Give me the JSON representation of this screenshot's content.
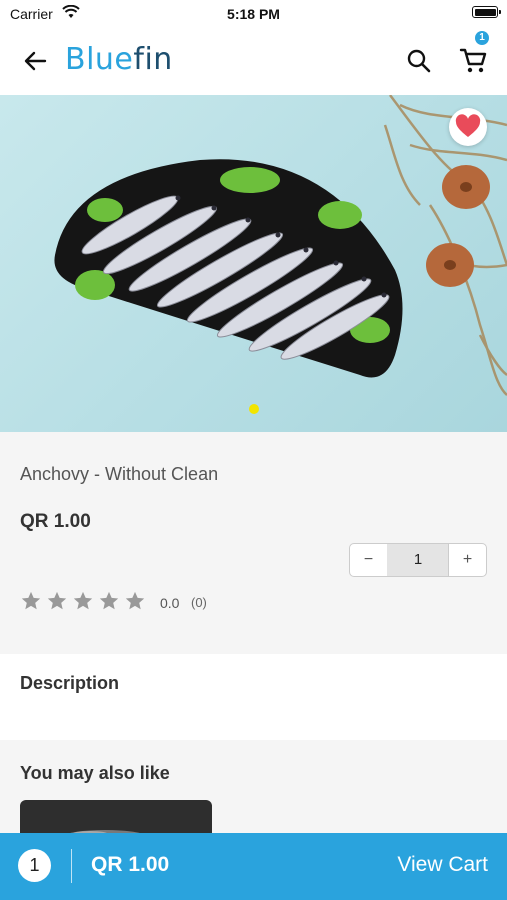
{
  "status_bar": {
    "carrier": "Carrier",
    "time": "5:18 PM"
  },
  "header": {
    "logo_prefix": "Blue",
    "logo_suffix": "fin",
    "cart_badge": "1"
  },
  "product": {
    "name": "Anchovy - Without Clean",
    "price": "QR 1.00",
    "quantity": "1",
    "minus_label": "−",
    "plus_label": "+",
    "rating": "0.0",
    "rating_count": "(0)",
    "stars_filled": 0,
    "stars_total": 5
  },
  "description": {
    "title": "Description"
  },
  "recommendations": {
    "title": "You may also like"
  },
  "bottom_bar": {
    "cart_count": "1",
    "total": "QR 1.00",
    "view_cart_label": "View Cart"
  },
  "colors": {
    "accent": "#2aa3dd",
    "logo_dark": "#1d4e6e",
    "heart": "#e94b5a",
    "pager_dot": "#f2e500"
  }
}
